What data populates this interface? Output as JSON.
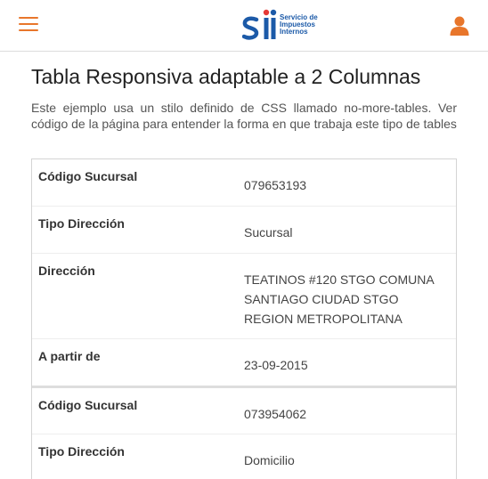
{
  "brand": {
    "logo_text_lines": [
      "Servicio de",
      "Impuestos",
      "Internos"
    ],
    "accent_color": "#e8762b",
    "logo_color": "#1c5aa8"
  },
  "icons": {
    "menu": "hamburger-menu-icon",
    "user": "user-icon",
    "logo": "sii-logo"
  },
  "page": {
    "title": "Tabla Responsiva adaptable a 2 Columnas",
    "intro": "Este ejemplo usa un stilo definido de CSS llamado no-more-tables. Ver código de la página para entender la forma en que trabaja este tipo de tables"
  },
  "records": [
    {
      "codigo_label": "Código Sucursal",
      "codigo_value": "079653193",
      "tipo_label": "Tipo Dirección",
      "tipo_value": "Sucursal",
      "direccion_label": "Dirección",
      "direccion_value": "TEATINOS #120 STGO COMUNA SANTIAGO CIUDAD STGO REGION METROPOLITANA",
      "desde_label": "A partir de",
      "desde_value": "23-09-2015"
    },
    {
      "codigo_label": "Código Sucursal",
      "codigo_value": "073954062",
      "tipo_label": "Tipo Dirección",
      "tipo_value": "Domicilio"
    }
  ]
}
